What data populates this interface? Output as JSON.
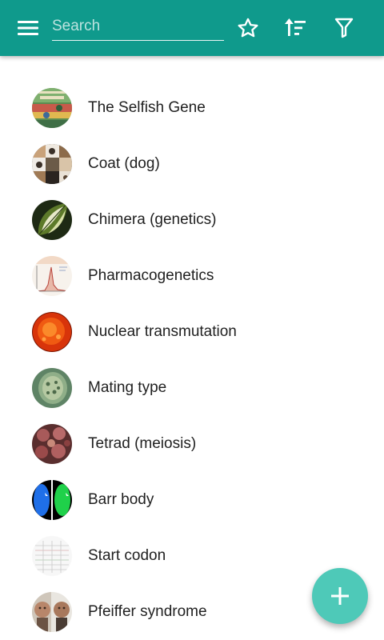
{
  "app_bar": {
    "background_color": "#0f9a8c",
    "menu_icon": "menu-icon",
    "search": {
      "placeholder": "Search",
      "value": ""
    },
    "actions": [
      {
        "name": "favorites",
        "icon": "star-outline-icon"
      },
      {
        "name": "sort",
        "icon": "sort-icon"
      },
      {
        "name": "filter",
        "icon": "filter-icon"
      }
    ]
  },
  "items": [
    {
      "title": "The Selfish Gene",
      "thumbnail": "book-cover-thumbnail"
    },
    {
      "title": "Coat (dog)",
      "thumbnail": "dog-collage-thumbnail"
    },
    {
      "title": "Chimera (genetics)",
      "thumbnail": "variegated-leaf-thumbnail"
    },
    {
      "title": "Pharmacogenetics",
      "thumbnail": "graph-thumbnail"
    },
    {
      "title": "Nuclear transmutation",
      "thumbnail": "sun-thumbnail"
    },
    {
      "title": "Mating type",
      "thumbnail": "cell-thumbnail"
    },
    {
      "title": "Tetrad (meiosis)",
      "thumbnail": "spores-thumbnail"
    },
    {
      "title": "Barr body",
      "thumbnail": "fluorescent-nuclei-thumbnail"
    },
    {
      "title": "Start codon",
      "thumbnail": "codon-table-thumbnail"
    },
    {
      "title": "Pfeiffer syndrome",
      "thumbnail": "portrait-thumbnail"
    }
  ],
  "fab": {
    "icon": "plus-icon",
    "color": "#4ec9b8"
  }
}
